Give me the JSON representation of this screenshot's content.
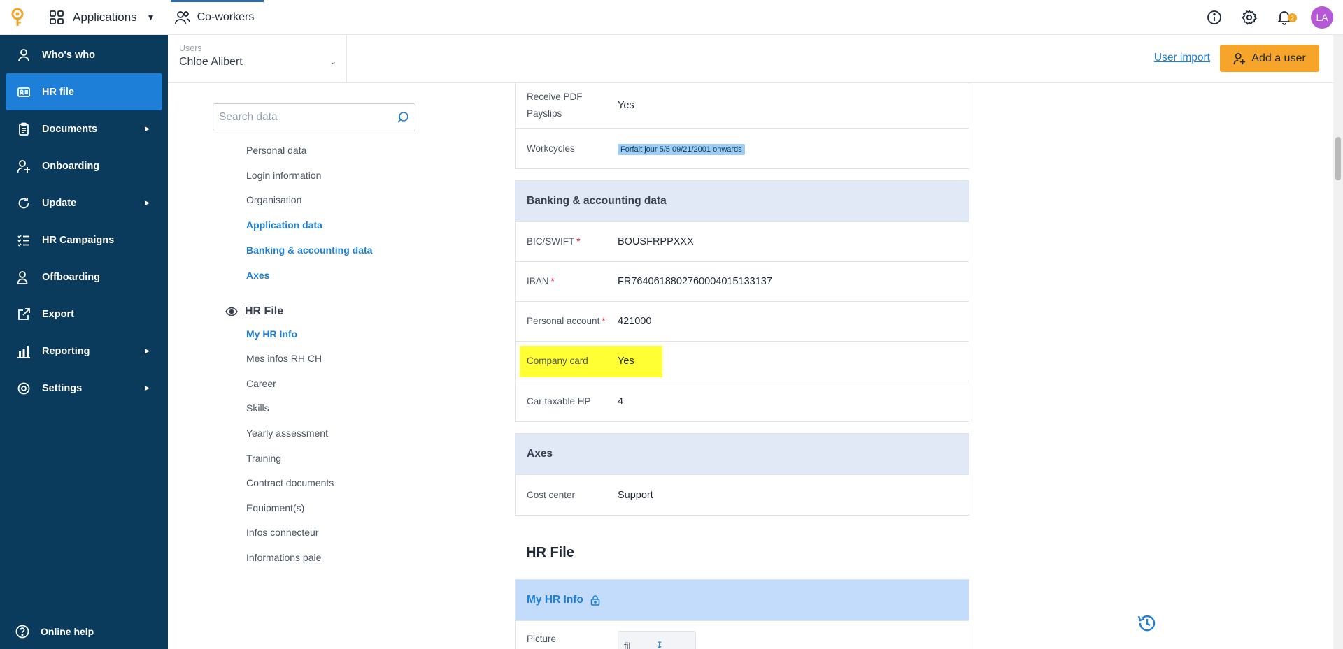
{
  "topbar": {
    "apps_label": "Applications",
    "coworkers_label": "Co-workers",
    "notifications_count": "2",
    "avatar_initials": "LA"
  },
  "sidebar": {
    "items": [
      {
        "label": "Who's who"
      },
      {
        "label": "HR file"
      },
      {
        "label": "Documents"
      },
      {
        "label": "Onboarding"
      },
      {
        "label": "Update"
      },
      {
        "label": "HR Campaigns"
      },
      {
        "label": "Offboarding"
      },
      {
        "label": "Export"
      },
      {
        "label": "Reporting"
      },
      {
        "label": "Settings"
      }
    ],
    "help_label": "Online help"
  },
  "subheader": {
    "users_label": "Users",
    "user_value": "Chloe Alibert",
    "user_import": "User import",
    "add_user": "Add a user"
  },
  "search": {
    "placeholder": "Search data"
  },
  "section_nav": {
    "links": [
      "Personal data",
      "Login information",
      "Organisation",
      "Application data",
      "Banking & accounting data",
      "Axes"
    ],
    "hr_file_heading": "HR File",
    "hr_links": [
      "My HR Info",
      "Mes infos RH CH",
      "Career",
      "Skills",
      "Yearly assessment",
      "Training",
      "Contract documents",
      "Equipment(s)",
      "Infos connecteur",
      "Informations paie"
    ]
  },
  "application_panel": {
    "receive_pdf_label": "Receive PDF Payslips",
    "receive_pdf_value": "Yes",
    "workcycles_label": "Workcycles",
    "workcycles_value": "Forfait jour 5/5 09/21/2001 onwards"
  },
  "banking": {
    "title": "Banking & accounting data",
    "bic_label": "BIC/SWIFT",
    "bic_value": "BOUSFRPPXXX",
    "iban_label": "IBAN",
    "iban_value": "FR7640618802760004015133137",
    "personal_account_label": "Personal account",
    "personal_account_value": "421000",
    "company_card_label": "Company card",
    "company_card_value": "Yes",
    "car_hp_label": "Car taxable HP",
    "car_hp_value": "4",
    "required_mark": "*"
  },
  "axes": {
    "title": "Axes",
    "cost_center_label": "Cost center",
    "cost_center_value": "Support"
  },
  "hr_file": {
    "title": "HR File",
    "my_hr_info_title": "My HR Info",
    "picture_label": "Picture",
    "file_button": "fil"
  },
  "colors": {
    "sidebar_bg": "#0b3b5c",
    "active_item": "#1d7fd8",
    "accent_orange": "#f6a52a",
    "highlight": "#ffff33"
  }
}
